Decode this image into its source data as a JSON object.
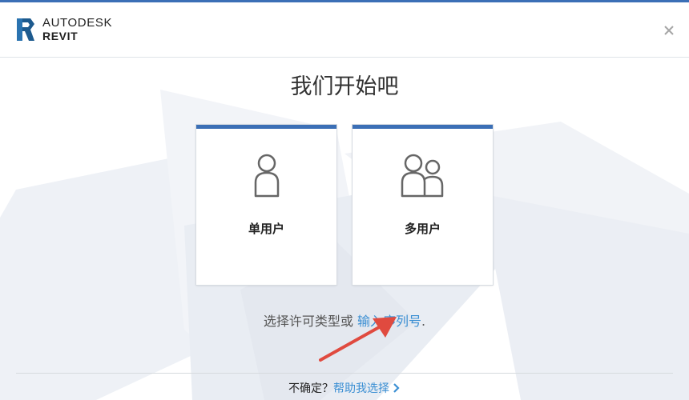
{
  "header": {
    "brand": "AUTODESK",
    "product": "REVIT",
    "close_icon": "close-icon"
  },
  "main": {
    "title": "我们开始吧",
    "cards": [
      {
        "label": "单用户",
        "icon": "single-user-icon"
      },
      {
        "label": "多用户",
        "icon": "multi-user-icon"
      }
    ],
    "license_prompt": "选择许可类型或",
    "serial_link": "输入序列号",
    "serial_suffix": "."
  },
  "footer": {
    "question": "不确定？",
    "help_link": "帮助我选择",
    "chevron_icon": "chevron-right-icon"
  },
  "colors": {
    "accent": "#3b6fb6",
    "link": "#3b8fd3",
    "arrow": "#e04a3f"
  }
}
